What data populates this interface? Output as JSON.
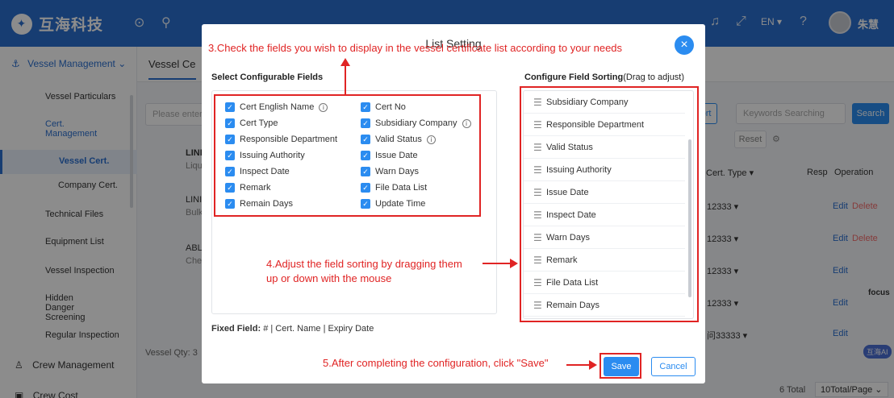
{
  "header": {
    "brand": "互海科技",
    "brand_icon": "logo-icon",
    "lang": "EN ▾",
    "user_name": "朱慧",
    "icons": [
      "back-circle-icon",
      "search-icon",
      "bell-icon",
      "fullscreen-icon",
      "help-icon"
    ]
  },
  "sidebar": {
    "group": "Vessel Management",
    "items": [
      {
        "label": "Vessel Particulars"
      },
      {
        "label": "Cert. Management"
      },
      {
        "label": "Vessel Cert."
      },
      {
        "label": "Company Cert."
      },
      {
        "label": "Technical Files"
      },
      {
        "label": "Equipment List"
      },
      {
        "label": "Vessel Inspection"
      },
      {
        "label": "Hidden Danger Screening"
      },
      {
        "label": "Regular Inspection"
      },
      {
        "label": "Crew Management"
      },
      {
        "label": "Crew Cost"
      }
    ]
  },
  "background": {
    "tab": "Vessel Ce",
    "search_placeholder": "Please enter",
    "keywords_placeholder": "Keywords Searching",
    "search_label": "Search",
    "export_label": "port",
    "reset_label": "Reset",
    "col_cert_type": "Cert. Type ▾",
    "col_resp": "Resp",
    "col_operation": "Operation",
    "rows": [
      {
        "name": "LINI",
        "sub": "Lique",
        "cert": "12333 ▾"
      },
      {
        "name": "LINI",
        "sub": "Bulk",
        "cert": "12333 ▾"
      },
      {
        "name": "ABL",
        "sub": "Chen",
        "cert": "12333 ▾"
      },
      {
        "name": "",
        "sub": "",
        "cert": "12333 ▾"
      },
      {
        "name": "",
        "sub": "",
        "cert": "问33333 ▾"
      }
    ],
    "edit": "Edit",
    "delete": "Delete",
    "vessel_qty": "Vessel Qty: 3",
    "total": "6 Total",
    "per_page": "10Total/Page ⌄",
    "focus": "focus",
    "ai_label": "互海AI"
  },
  "modal": {
    "title": "List Setting",
    "left_title": "Select Configurable Fields",
    "right_title": "Configure Field Sorting",
    "right_title_hint": "(Drag to adjust)",
    "fields_col1": [
      {
        "label": "Cert English Name",
        "info": true
      },
      {
        "label": "Cert Type",
        "info": false
      },
      {
        "label": "Responsible Department",
        "info": false
      },
      {
        "label": "Issuing Authority",
        "info": false
      },
      {
        "label": "Inspect Date",
        "info": false
      },
      {
        "label": "Remark",
        "info": false
      },
      {
        "label": "Remain Days",
        "info": false
      }
    ],
    "fields_col2": [
      {
        "label": "Cert No",
        "info": false
      },
      {
        "label": "Subsidiary Company",
        "info": true
      },
      {
        "label": "Valid Status",
        "info": true
      },
      {
        "label": "Issue Date",
        "info": false
      },
      {
        "label": "Warn Days",
        "info": false
      },
      {
        "label": "File Data List",
        "info": false
      },
      {
        "label": "Update Time",
        "info": false
      }
    ],
    "sort_items": [
      "Subsidiary Company",
      "Responsible Department",
      "Valid Status",
      "Issuing Authority",
      "Issue Date",
      "Inspect Date",
      "Warn Days",
      "Remark",
      "File Data List",
      "Remain Days"
    ],
    "fixed_label": "Fixed Field:",
    "fixed_value": "# | Cert. Name | Expiry Date",
    "save": "Save",
    "cancel": "Cancel"
  },
  "annotations": {
    "step3": "3.Check the fields you wish to display in the vessel certificate list according to your needs",
    "step4_line1": "4.Adjust the field sorting by dragging them",
    "step4_line2": "up or down with the mouse",
    "step5": "5.After completing the configuration, click \"Save\"",
    "color": "#e02424"
  }
}
